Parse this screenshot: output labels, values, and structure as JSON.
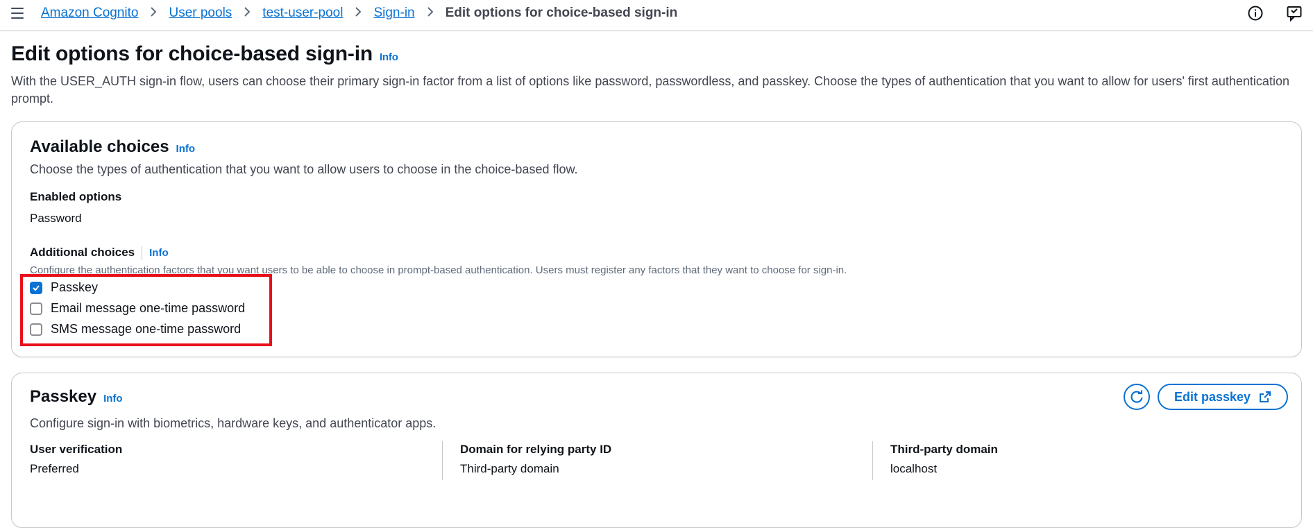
{
  "breadcrumb": {
    "items": [
      "Amazon Cognito",
      "User pools",
      "test-user-pool",
      "Sign-in"
    ],
    "current": "Edit options for choice-based sign-in"
  },
  "page": {
    "title": "Edit options for choice-based sign-in",
    "info": "Info",
    "description": "With the USER_AUTH sign-in flow, users can choose their primary sign-in factor from a list of options like password, passwordless, and passkey. Choose the types of authentication that you want to allow for users' first authentication prompt."
  },
  "available": {
    "title": "Available choices",
    "info": "Info",
    "description": "Choose the types of authentication that you want to allow users to choose in the choice-based flow.",
    "enabled_label": "Enabled options",
    "enabled_value": "Password",
    "additional_label": "Additional choices",
    "additional_info": "Info",
    "additional_desc": "Configure the authentication factors that you want users to be able to choose in prompt-based authentication. Users must register any factors that they want to choose for sign-in.",
    "choices": [
      {
        "label": "Passkey",
        "checked": true
      },
      {
        "label": "Email message one-time password",
        "checked": false
      },
      {
        "label": "SMS message one-time password",
        "checked": false
      }
    ]
  },
  "passkey": {
    "title": "Passkey",
    "info": "Info",
    "description": "Configure sign-in with biometrics, hardware keys, and authenticator apps.",
    "edit_button": "Edit passkey",
    "fields": [
      {
        "label": "User verification",
        "value": "Preferred"
      },
      {
        "label": "Domain for relying party ID",
        "value": "Third-party domain"
      },
      {
        "label": "Third-party domain",
        "value": "localhost"
      }
    ]
  },
  "colors": {
    "accent": "#0972d3",
    "highlight": "#e8101b"
  },
  "icons": [
    "menu-icon",
    "chevron-right-icon",
    "info-circle-icon",
    "feedback-icon",
    "refresh-icon",
    "external-link-icon",
    "check-icon"
  ]
}
